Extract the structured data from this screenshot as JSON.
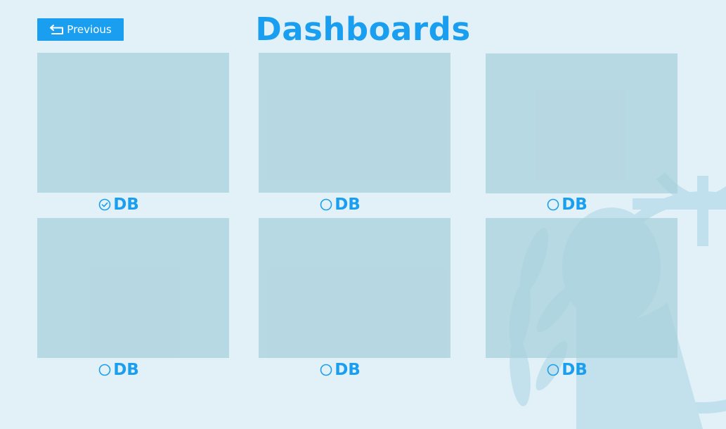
{
  "header": {
    "title": "Dashboards",
    "previous_label": "Previous"
  },
  "dashboards": [
    {
      "label": "DB",
      "selected": true
    },
    {
      "label": "DB",
      "selected": false
    },
    {
      "label": "DB",
      "selected": false
    },
    {
      "label": "DB",
      "selected": false
    },
    {
      "label": "DB",
      "selected": false
    },
    {
      "label": "DB",
      "selected": false
    }
  ],
  "icons": {
    "previous": "return-arrow-icon",
    "selected": "check-circle-icon",
    "unselected": "empty-circle-icon",
    "watermark": "globe-emblem-icon"
  },
  "colors": {
    "accent": "#1a9ff0",
    "background": "#e2f1f7",
    "thumbnail": "#b8dbe5"
  }
}
